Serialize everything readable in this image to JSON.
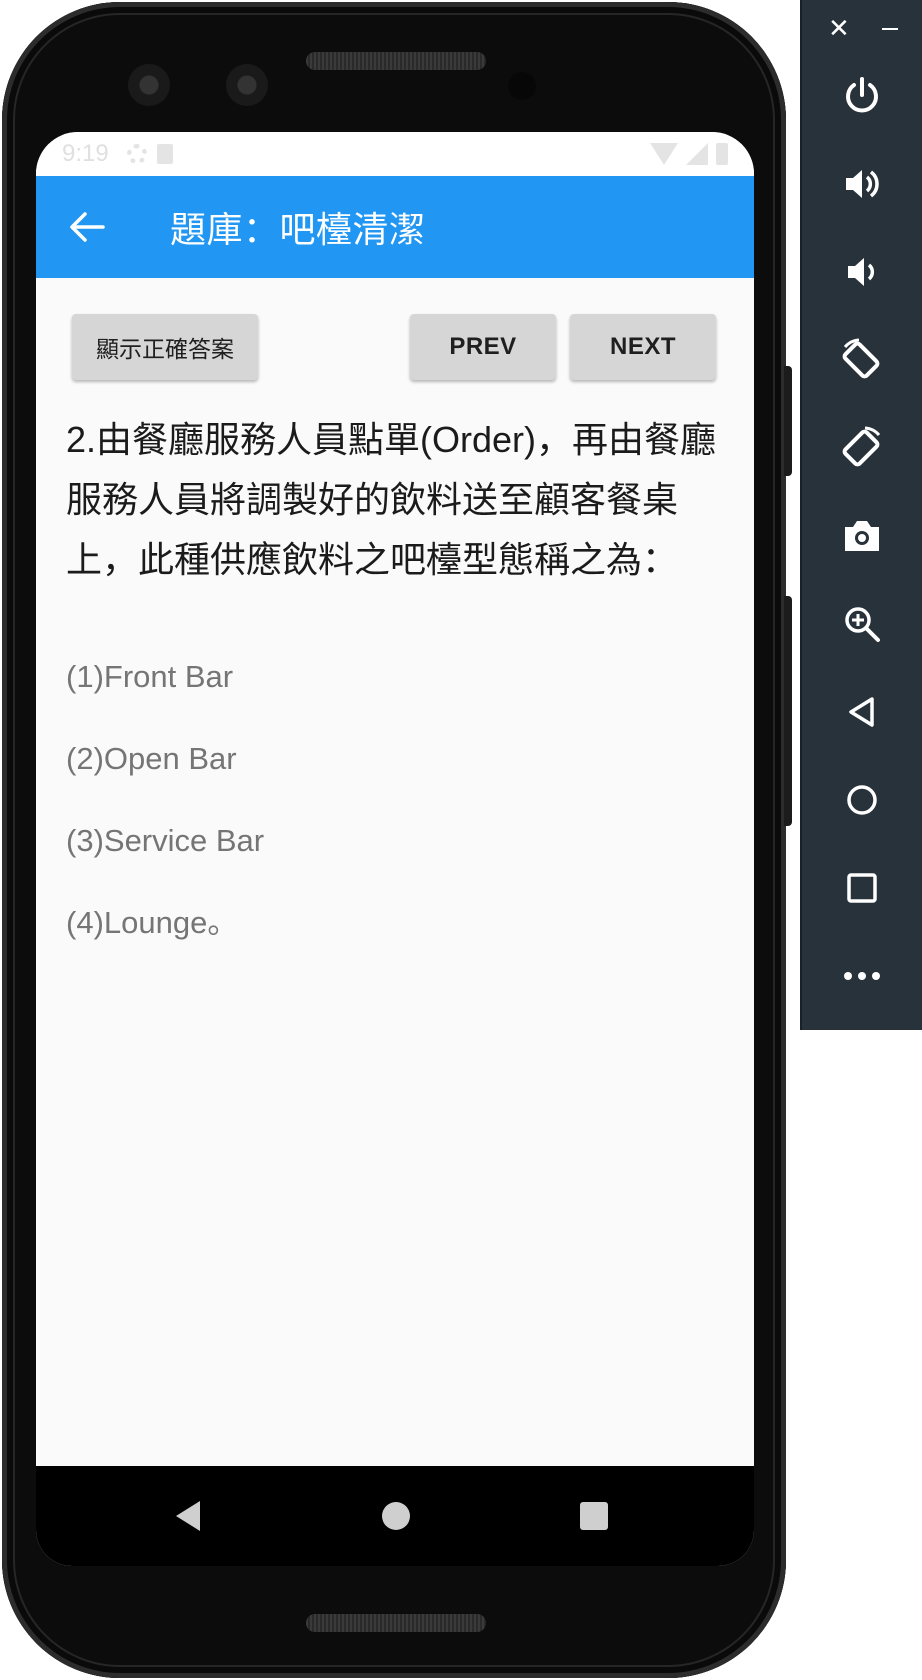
{
  "status_bar": {
    "time": "9:19"
  },
  "app_bar": {
    "title": "題庫：吧檯清潔",
    "back_icon": "arrow-left-icon"
  },
  "buttons": {
    "show_answer_label": "顯示正確答案",
    "prev_label": "PREV",
    "next_label": "NEXT"
  },
  "question": {
    "text": "2.由餐廳服務人員點單(Order)，再由餐廳服務人員將調製好的飲料送至顧客餐桌上，此種供應飲料之吧檯型態稱之為："
  },
  "options": [
    {
      "text": "(1)Front Bar"
    },
    {
      "text": "(2)Open Bar"
    },
    {
      "text": "(3)Service Bar"
    },
    {
      "text": "(4)Lounge。"
    }
  ],
  "nav_bar": {
    "back_icon": "nav-back-icon",
    "home_icon": "nav-home-icon",
    "recent_icon": "nav-recents-icon"
  },
  "emulator_toolbar": {
    "items": [
      "power-icon",
      "volume-up-icon",
      "volume-down-icon",
      "rotate-left-icon",
      "rotate-right-icon",
      "camera-icon",
      "zoom-icon",
      "back-icon",
      "home-icon",
      "overview-icon",
      "more-icon"
    ]
  },
  "colors": {
    "app_bar": "#2196f3",
    "button": "#d6d6d6",
    "toolbar": "#27323a",
    "option_text": "#757575"
  }
}
